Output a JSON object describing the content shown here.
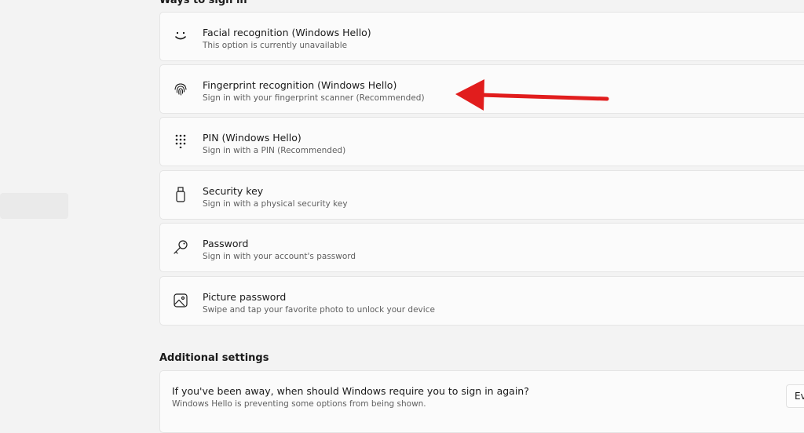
{
  "headings": {
    "ways_to_sign_in": "Ways to sign in",
    "additional_settings": "Additional settings"
  },
  "sign_in_options": [
    {
      "title": "Facial recognition (Windows Hello)",
      "subtitle": "This option is currently unavailable",
      "icon": "smile-icon"
    },
    {
      "title": "Fingerprint recognition (Windows Hello)",
      "subtitle": "Sign in with your fingerprint scanner (Recommended)",
      "icon": "fingerprint-icon"
    },
    {
      "title": "PIN (Windows Hello)",
      "subtitle": "Sign in with a PIN (Recommended)",
      "icon": "keypad-icon"
    },
    {
      "title": "Security key",
      "subtitle": "Sign in with a physical security key",
      "icon": "usb-key-icon"
    },
    {
      "title": "Password",
      "subtitle": "Sign in with your account's password",
      "icon": "key-icon"
    },
    {
      "title": "Picture password",
      "subtitle": "Swipe and tap your favorite photo to unlock your device",
      "icon": "picture-icon"
    }
  ],
  "additional": {
    "question": "If you've been away, when should Windows require you to sign in again?",
    "note": "Windows Hello is preventing some options from being shown.",
    "dropdown_value": "Every Time"
  },
  "colors": {
    "annotation_arrow": "#e11d1d"
  }
}
